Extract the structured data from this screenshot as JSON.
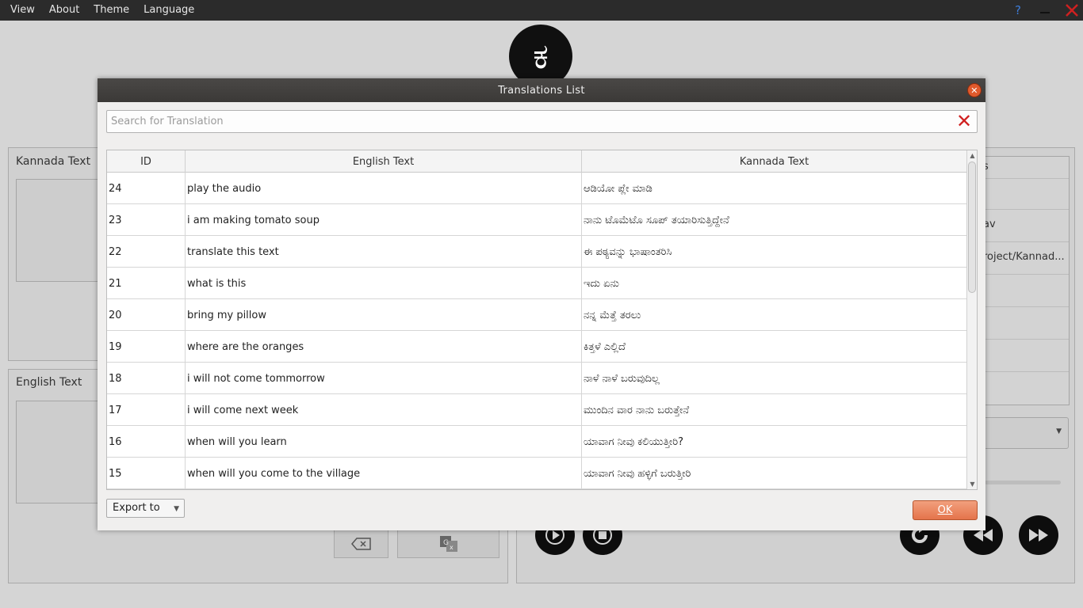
{
  "menubar": {
    "items": [
      "View",
      "About",
      "Theme",
      "Language"
    ],
    "help_icon": "question-mark-icon",
    "minimize_icon": "minimize-icon",
    "close_icon": "close-icon"
  },
  "app": {
    "logo_glyph": "ಕ",
    "kannada_label": "Kannada Text",
    "english_label": "English Text",
    "right_table": {
      "header_fragment": "s",
      "row1": "av",
      "row2": "roject/Kannad..."
    }
  },
  "dialog": {
    "title": "Translations List",
    "search_placeholder": "Search for Translation",
    "search_value": "",
    "columns": [
      "ID",
      "English Text",
      "Kannada Text"
    ],
    "rows": [
      {
        "id": "24",
        "en": "play the audio",
        "kn": "ಆಡಿಯೋ ಪ್ಲೇ ಮಾಡಿ"
      },
      {
        "id": "23",
        "en": "i am making tomato soup",
        "kn": "ನಾನು ಟೊಮೆಟೊ ಸೂಪ್ ತಯಾರಿಸುತ್ತಿದ್ದೇನೆ"
      },
      {
        "id": "22",
        "en": "translate this text",
        "kn": "ಈ ಪಠ್ಯವನ್ನು ಭಾಷಾಂತರಿಸಿ"
      },
      {
        "id": "21",
        "en": "what is this",
        "kn": "ಇದು ಏನು"
      },
      {
        "id": "20",
        "en": "bring my pillow",
        "kn": "ನನ್ನ ಮೆತ್ತೆ ತರಲು"
      },
      {
        "id": "19",
        "en": "where are the oranges",
        "kn": "ಕಿತ್ತಳೆ ಎಲ್ಲಿದೆ"
      },
      {
        "id": "18",
        "en": "i will not come tommorrow",
        "kn": "ನಾಳೆ ನಾಳೆ ಬರುವುದಿಲ್ಲ"
      },
      {
        "id": "17",
        "en": "i will come next week",
        "kn": "ಮುಂದಿನ ವಾರ ನಾನು ಬರುತ್ತೇನೆ"
      },
      {
        "id": "16",
        "en": "when will you learn",
        "kn": "ಯಾವಾಗ ನೀವು ಕಲಿಯುತ್ತೀರಿ?"
      },
      {
        "id": "15",
        "en": "when will you come to the village",
        "kn": "ಯಾವಾಗ ನೀವು ಹಳ್ಳಿಗೆ ಬರುತ್ತೀರಿ"
      }
    ],
    "export_label": "Export to",
    "ok_label": "OK"
  }
}
